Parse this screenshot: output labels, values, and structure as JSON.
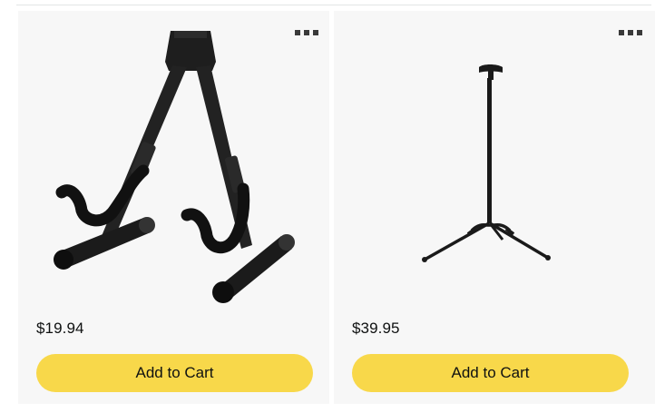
{
  "colors": {
    "card_background": "#f7f7f7",
    "button_background": "#f8d84a",
    "text": "#0f1111"
  },
  "products": [
    {
      "price": "$19.94",
      "cart_label": "Add to Cart",
      "image_icon": "a-frame-guitar-stand",
      "menu_icon": "more-options-icon"
    },
    {
      "price": "$39.95",
      "cart_label": "Add to Cart",
      "image_icon": "tripod-guitar-stand",
      "menu_icon": "more-options-icon"
    }
  ]
}
